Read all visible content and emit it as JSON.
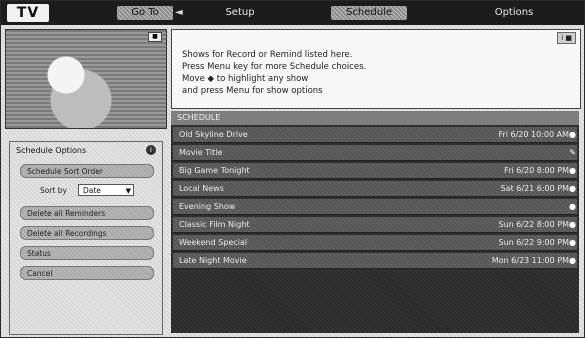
{
  "header": {
    "logo": "TV",
    "tabs": [
      "Go To",
      "Setup",
      "Schedule",
      "Options"
    ],
    "active_tab_index": 2,
    "tab_arrow": "◄"
  },
  "preview": {
    "badge": "■"
  },
  "info": {
    "badge": "i ■",
    "lines": [
      "Shows for Record or Remind listed here.",
      "Press Menu key for more Schedule choices.",
      "Move ◆ to highlight any show",
      "and press Menu for show options"
    ]
  },
  "schedule": {
    "header": "SCHEDULE",
    "rows": [
      {
        "title": "Old Skyline Drive",
        "time": "Fri 6/20  10:00 AM",
        "icon": "●"
      },
      {
        "title": "Movie Title",
        "time": "",
        "icon": "✎"
      },
      {
        "title": "Big Game Tonight",
        "time": "Fri 6/20  8:00 PM",
        "icon": "●"
      },
      {
        "title": "Local News",
        "time": "Sat 6/21  6:00 PM",
        "icon": "●"
      },
      {
        "title": "Evening Show",
        "time": "",
        "icon": "●"
      },
      {
        "title": "Classic Film Night",
        "time": "Sun 6/22  8:00 PM",
        "icon": "●"
      },
      {
        "title": "Weekend Special",
        "time": "Sun 6/22  9:00 PM",
        "icon": "●"
      },
      {
        "title": "Late Night Movie",
        "time": "Mon 6/23  11:00 PM",
        "icon": "●"
      }
    ]
  },
  "options": {
    "title": "Schedule Options",
    "info_icon": "i",
    "sort_button": "Schedule Sort Order",
    "sort_label": "Sort by",
    "sort_value": "Date",
    "buttons": [
      "Delete all Reminders",
      "Delete all Recordings",
      "Status",
      "Cancel"
    ]
  }
}
